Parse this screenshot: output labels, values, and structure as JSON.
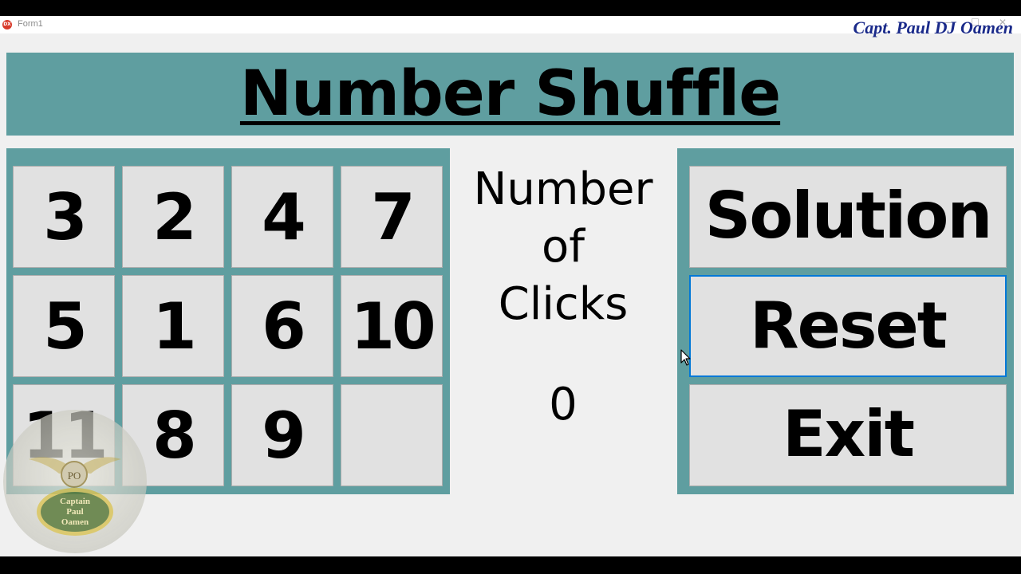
{
  "window": {
    "title": "Form1",
    "controls": {
      "minimize": "—",
      "maximize": "☐",
      "close": "✕"
    }
  },
  "watermark": {
    "text": "Capt. Paul DJ Oamen",
    "badge": {
      "initials": "PO",
      "line1": "Captain",
      "line2": "Paul",
      "line3": "Oamen"
    }
  },
  "header": {
    "title": "Number Shuffle"
  },
  "grid": {
    "tiles": [
      [
        "3",
        "2",
        "4",
        "7"
      ],
      [
        "5",
        "1",
        "6",
        "10"
      ],
      [
        "11",
        "8",
        "9",
        ""
      ]
    ]
  },
  "counter": {
    "label": "Number\nof\nClicks",
    "value": "0"
  },
  "actions": {
    "solution_label": "Solution",
    "reset_label": "Reset",
    "exit_label": "Exit"
  },
  "colors": {
    "panel": "#5f9ea0",
    "tile": "#e1e1e1",
    "form_background": "#f0f0f0",
    "focus_border": "#0078d7",
    "watermark_text": "#1a2a8a"
  }
}
